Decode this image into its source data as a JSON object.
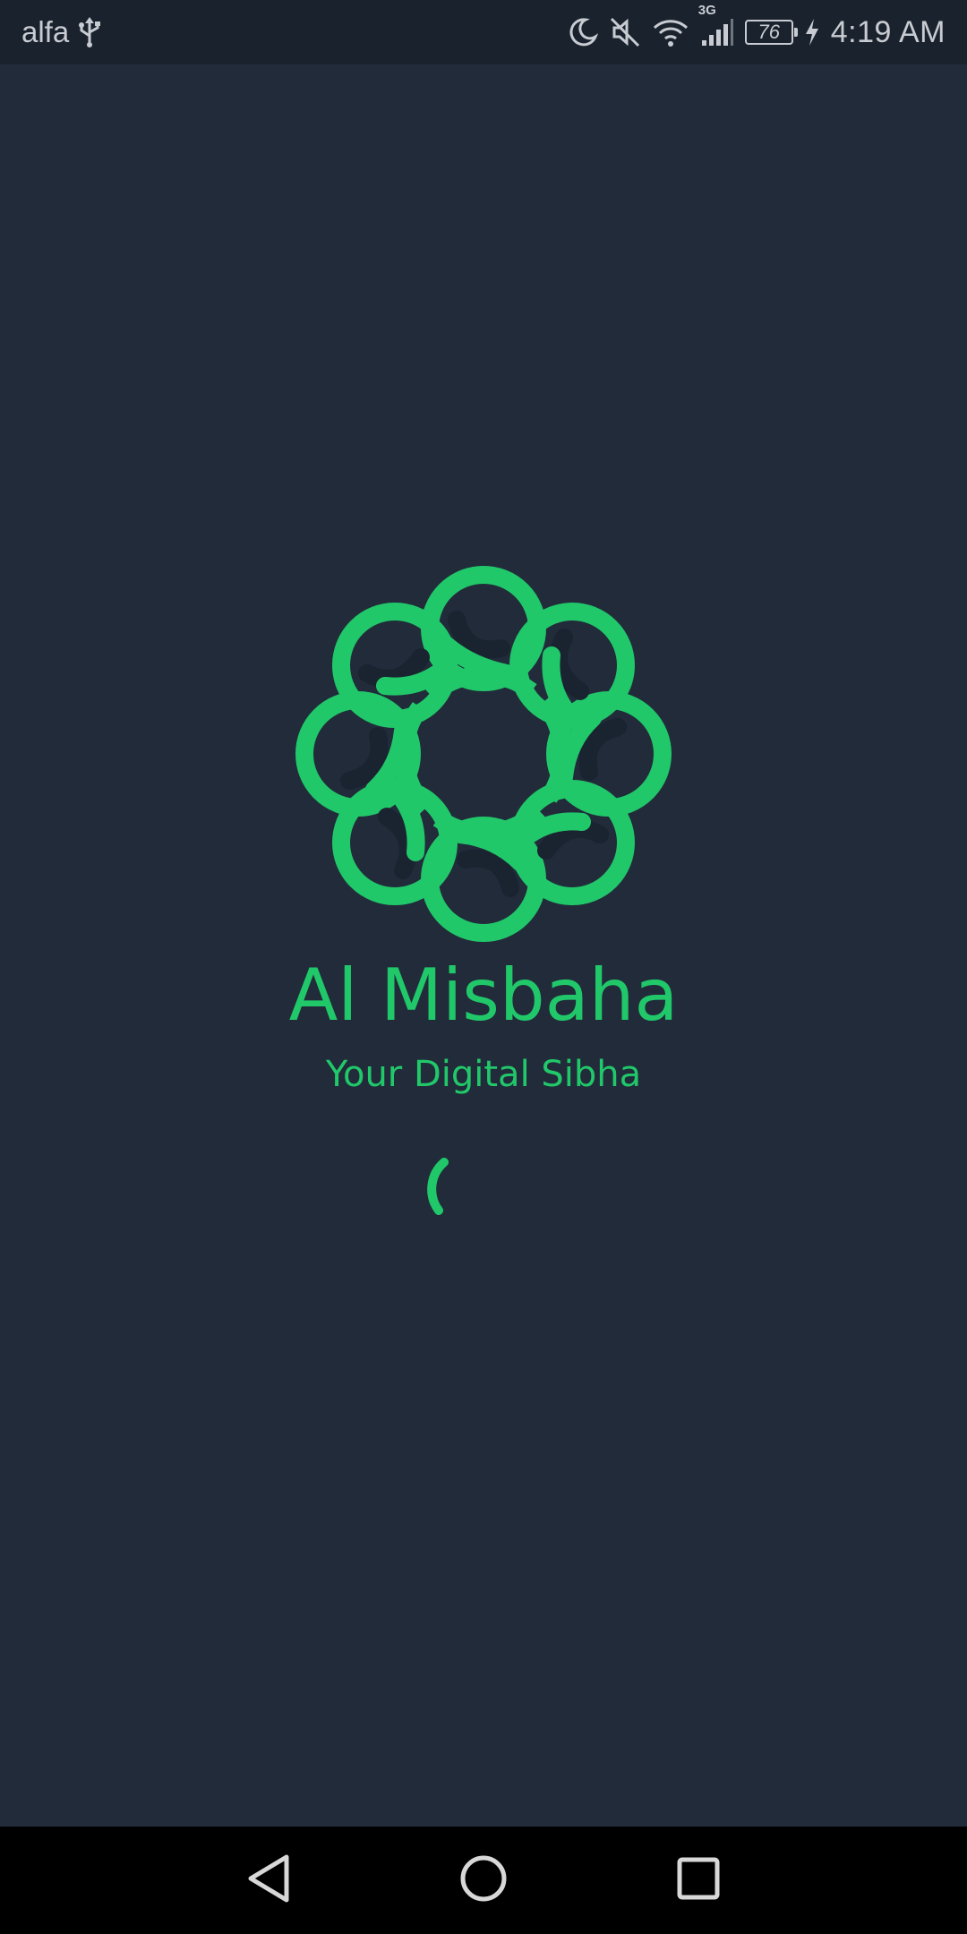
{
  "status_bar": {
    "carrier": "alfa",
    "network_type": "3G",
    "battery_level": "76",
    "time": "4:19 AM",
    "icons": [
      "usb-icon",
      "moon-icon",
      "mute-icon",
      "wifi-icon",
      "signal-icon",
      "charging-icon"
    ]
  },
  "splash": {
    "title": "Al Misbaha",
    "subtitle": "Your Digital Sibha"
  },
  "navigation": {
    "icons": [
      "back-icon",
      "home-icon",
      "recents-icon"
    ]
  },
  "colors": {
    "background": "#212b3a",
    "status_bar": "#1a222d",
    "accent": "#21c86a",
    "knot_shadow": "#1a2330",
    "nav_bar": "#000000"
  }
}
